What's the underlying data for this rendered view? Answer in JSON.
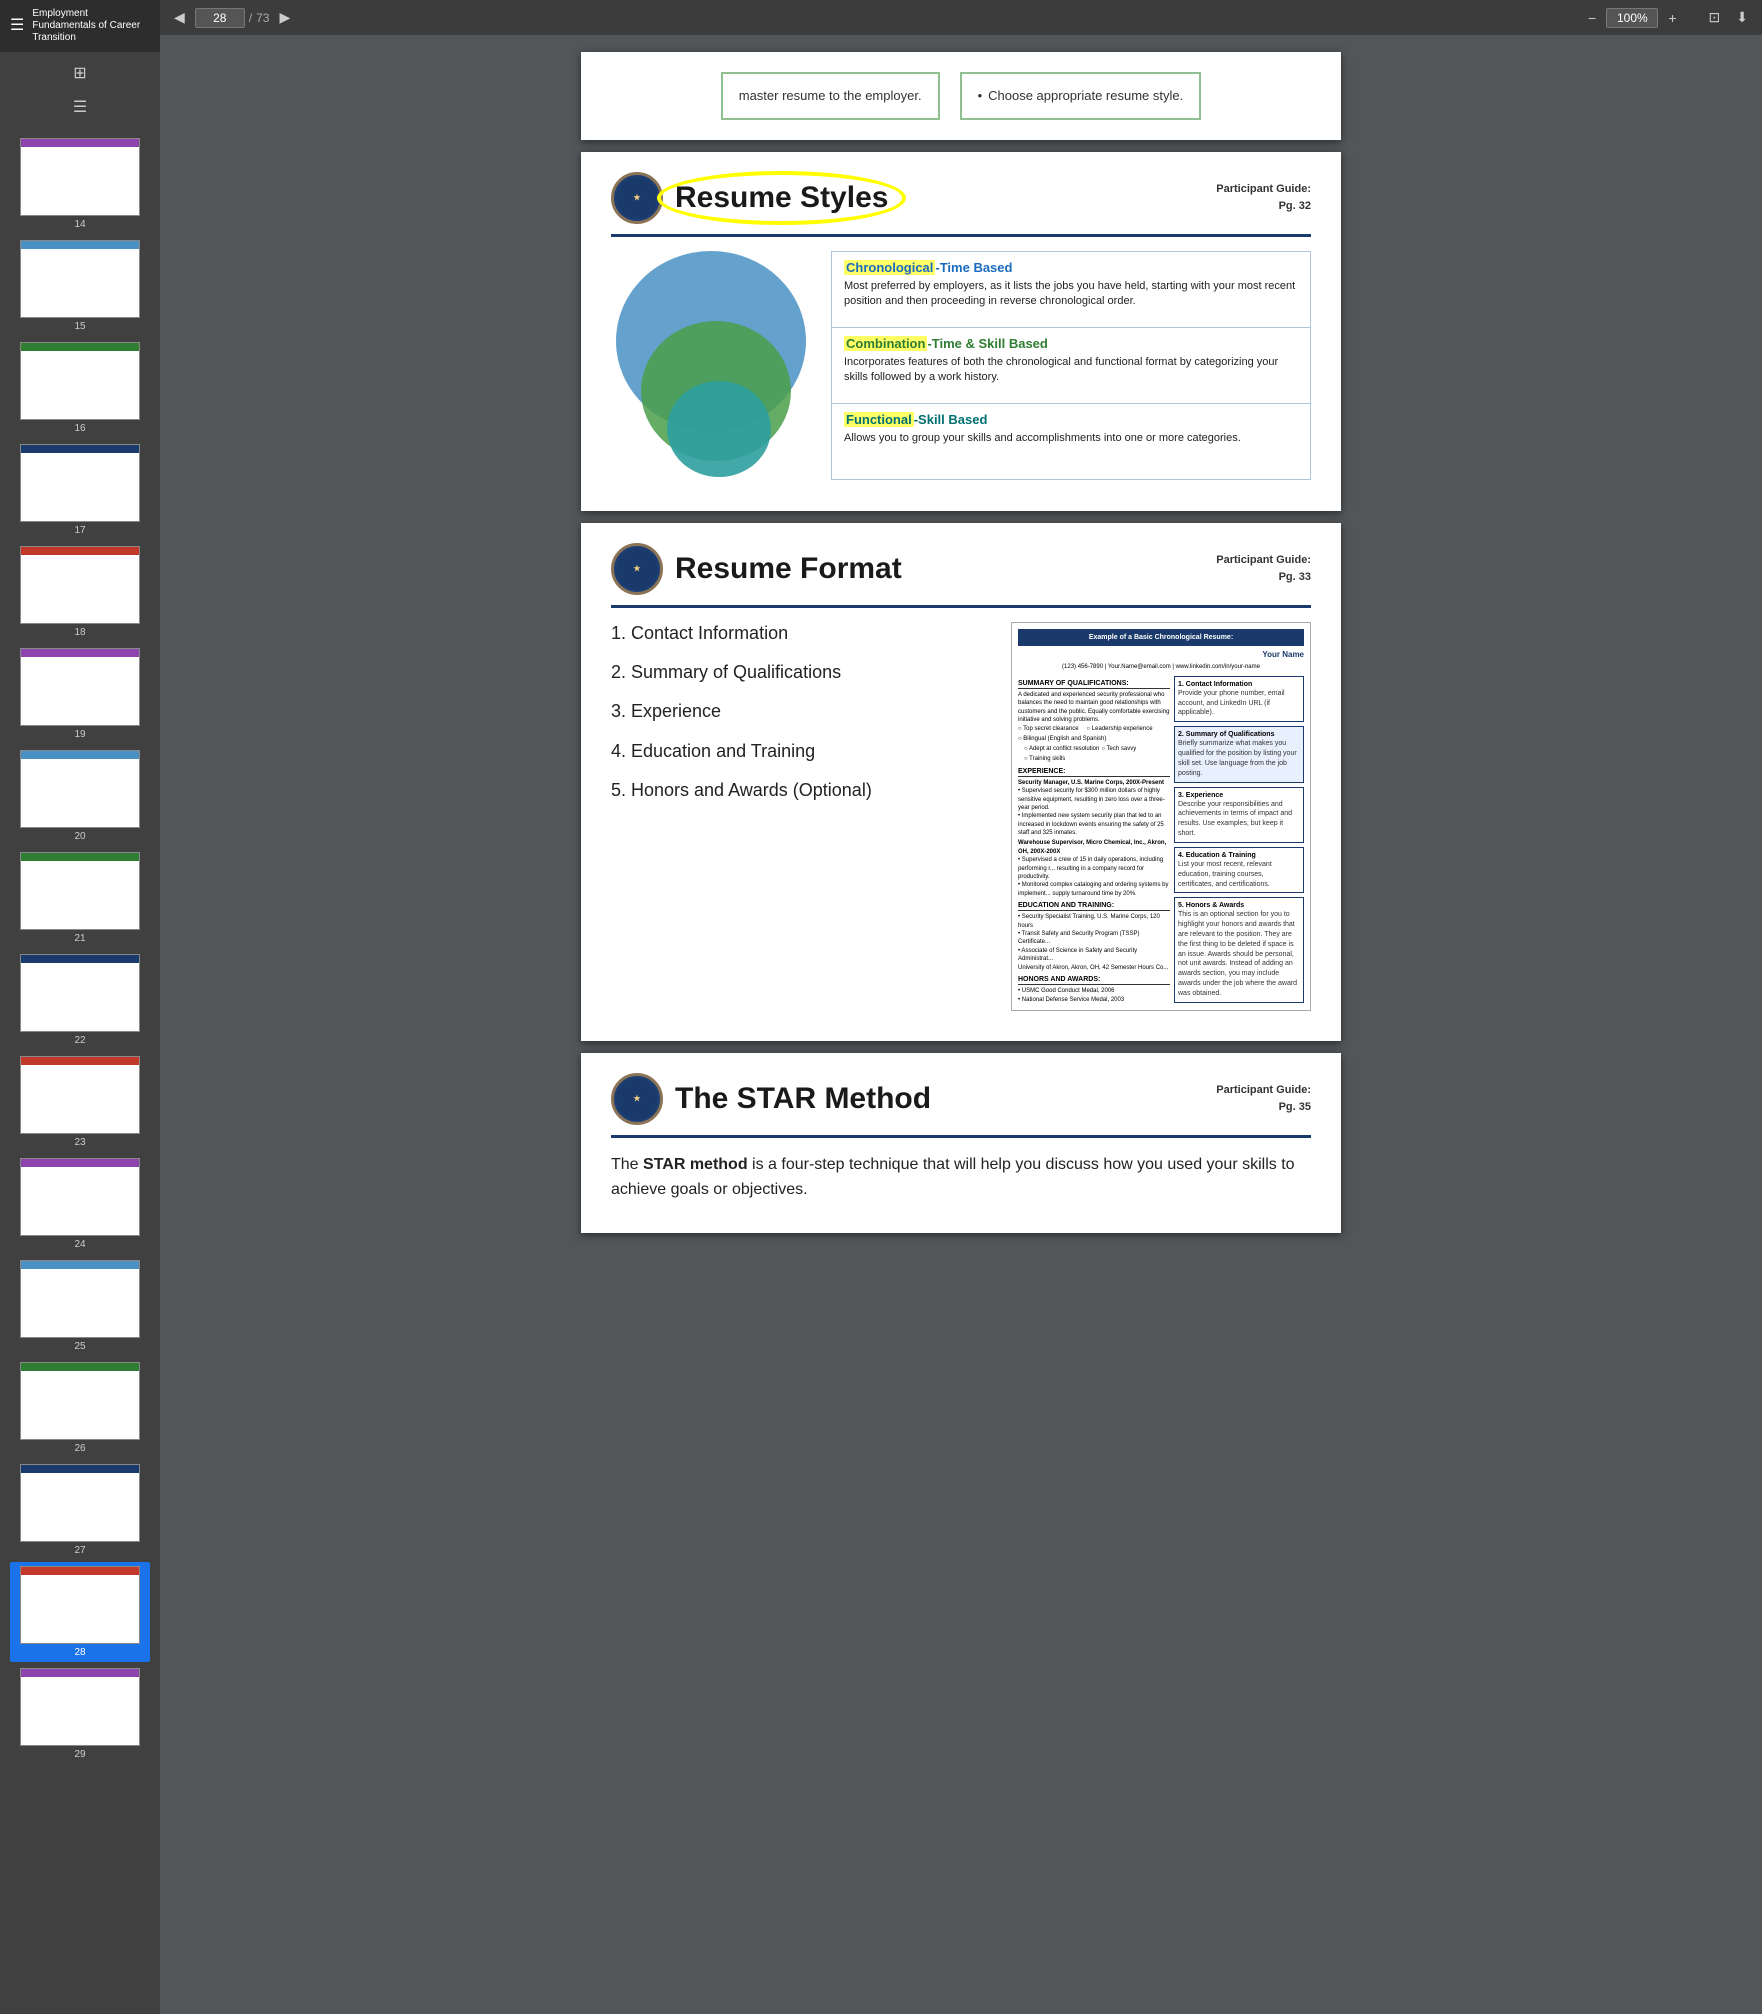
{
  "app": {
    "title": "Employment Fundamentals of Career Transition"
  },
  "toolbar": {
    "page_current": "28",
    "page_total": "73",
    "zoom": "100%",
    "minus_label": "−",
    "plus_label": "+"
  },
  "sidebar": {
    "thumbnails": [
      {
        "num": "14",
        "active": false
      },
      {
        "num": "15",
        "active": false
      },
      {
        "num": "16",
        "active": false
      },
      {
        "num": "17",
        "active": false
      },
      {
        "num": "18",
        "active": false
      },
      {
        "num": "19",
        "active": false
      },
      {
        "num": "20",
        "active": false
      },
      {
        "num": "21",
        "active": false
      },
      {
        "num": "22",
        "active": false
      },
      {
        "num": "23",
        "active": false
      },
      {
        "num": "24",
        "active": false
      },
      {
        "num": "25",
        "active": false
      },
      {
        "num": "26",
        "active": false
      },
      {
        "num": "27",
        "active": false
      },
      {
        "num": "28",
        "active": true
      },
      {
        "num": "29",
        "active": false
      }
    ]
  },
  "slides": {
    "partial_top": {
      "box1_text": "master resume to the employer.",
      "box2_bullet": "Choose appropriate resume style."
    },
    "resume_styles": {
      "title": "Resume Styles",
      "participant_guide_label": "Participant Guide:",
      "participant_guide_page": "Pg. 32",
      "chronological_title": "Chronological",
      "chronological_subtitle": "-Time Based",
      "chronological_text": "Most preferred by employers, as it lists the jobs you have held, starting with your most recent position and then proceeding in reverse chronological order.",
      "combination_title": "Combination",
      "combination_subtitle": "-Time & Skill Based",
      "combination_text": "Incorporates features of both the chronological and functional format by categorizing your skills followed by a work history.",
      "functional_title": "Functional",
      "functional_subtitle": "-Skill Based",
      "functional_text": "Allows you to group your skills and accomplishments into one or more categories."
    },
    "resume_format": {
      "title": "Resume Format",
      "participant_guide_label": "Participant Guide:",
      "participant_guide_page": "Pg. 33",
      "items": [
        "1.  Contact Information",
        "2.  Summary of Qualifications",
        "3.  Experience",
        "4.  Education and Training",
        "5.  Honors and Awards (Optional)"
      ],
      "example_header": "Example of a Basic Chronological Resume:",
      "example_name": "Your Name",
      "example_contact": "(123) 456-7890 | Your.Name@email.com | www.linkedin.com/in/your-name",
      "annotations": [
        {
          "title": "1. Contact Information",
          "text": "Provide your phone number, email account, and LinkedIn URL (if applicable)."
        },
        {
          "title": "2. Summary of Qualifications",
          "text": "Briefly summarize what makes you qualified for the position by listing your skill set. Use language from the job posting."
        },
        {
          "title": "3. Experience",
          "text": "Describe your responsibilities and achievements in terms of impact and results. Use examples, but keep it short."
        },
        {
          "title": "4. Education & Training",
          "text": "List your most recent, relevant education, training courses, certificates, and certifications."
        },
        {
          "title": "5. Honors & Awards",
          "text": "This is an optional section for you to highlight your honors and awards that are relevant to the position. They are the first thing to be deleted if space is an issue. Awards should be personal, not unit awards. Instead of adding an awards section, you may include awards under the job where the award was obtained."
        }
      ]
    },
    "star_method": {
      "title": "The STAR Method",
      "participant_guide_label": "Participant Guide:",
      "participant_guide_page": "Pg. 35",
      "text_part1": "The ",
      "text_bold": "STAR method",
      "text_part2": " is a four-step technique that will help you discuss how you used your skills to achieve goals or objectives."
    }
  }
}
